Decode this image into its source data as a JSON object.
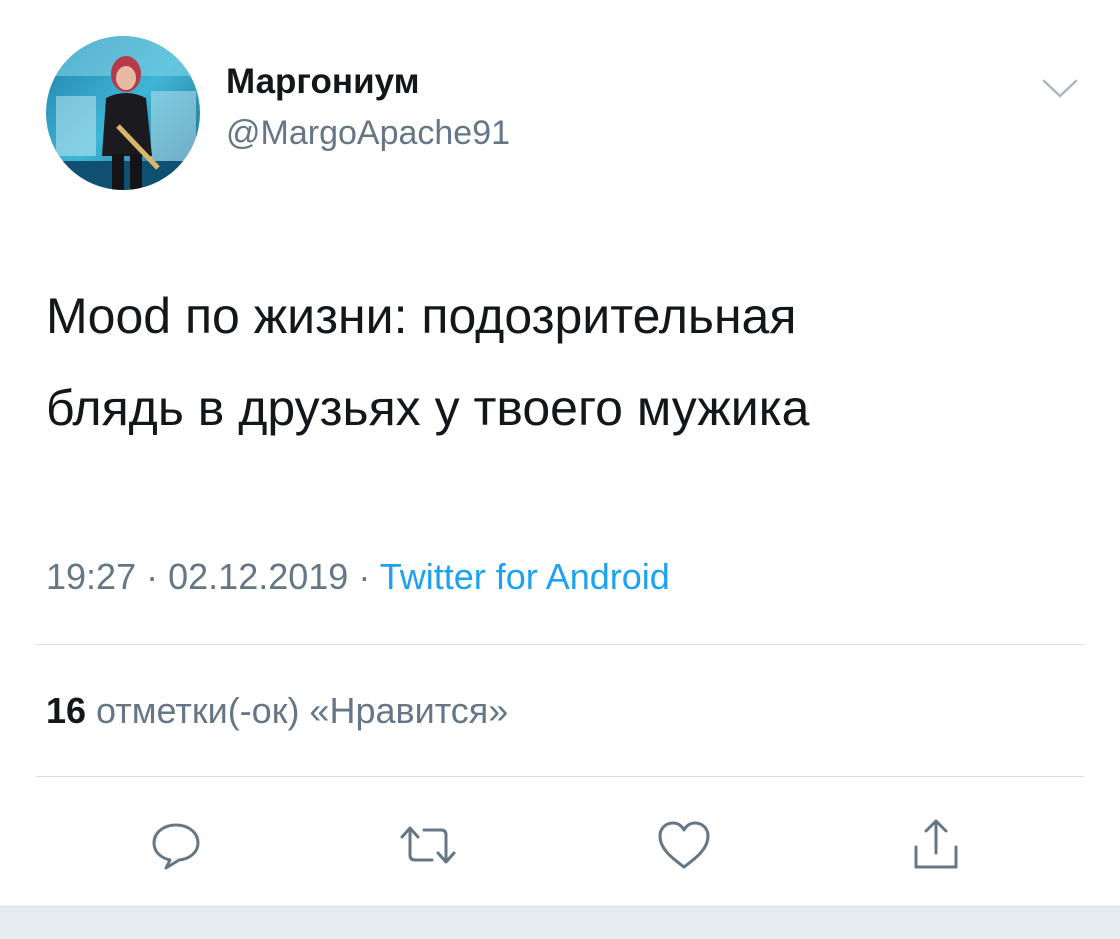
{
  "user": {
    "display_name": "Маргониум",
    "handle": "@MargoApache91",
    "avatar_icon": "profile-photo"
  },
  "tweet": {
    "text_lines": [
      "Mood по жизни: подозрительная",
      "блядь в друзьях у твоего мужика"
    ],
    "time": "19:27",
    "separator": "·",
    "date": "02.12.2019",
    "source": "Twitter for Android"
  },
  "likes": {
    "count": "16",
    "label": "отметки(-ок) «Нравится»"
  },
  "actions": [
    {
      "name": "reply",
      "icon": "reply-icon"
    },
    {
      "name": "retweet",
      "icon": "retweet-icon"
    },
    {
      "name": "like",
      "icon": "heart-icon"
    },
    {
      "name": "share",
      "icon": "share-icon"
    }
  ],
  "colors": {
    "text": "#14171a",
    "secondary": "#657786",
    "link": "#1da1f2",
    "divider": "#d7dde2"
  }
}
